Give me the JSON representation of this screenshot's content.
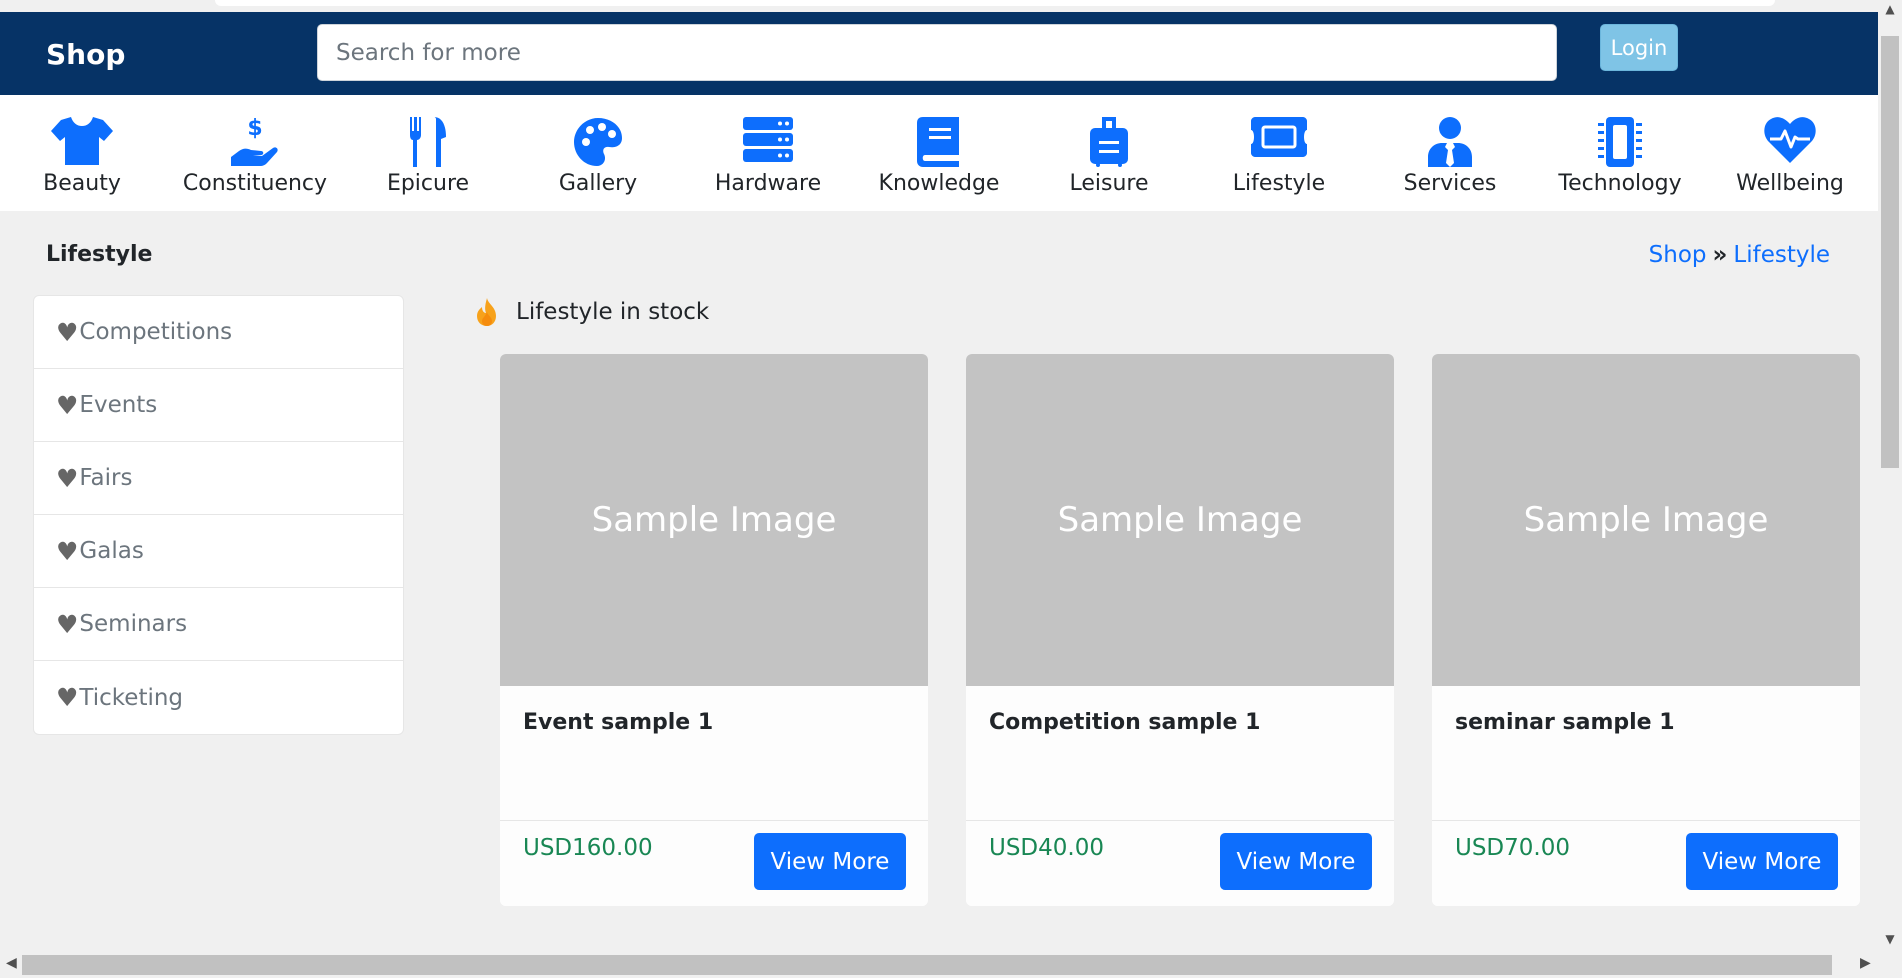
{
  "header": {
    "brand": "Shop",
    "search_placeholder": "Search for more",
    "login_label": "Login"
  },
  "categories": [
    {
      "label": "Beauty",
      "icon": "tshirt-icon"
    },
    {
      "label": "Constituency",
      "icon": "hand-dollar-icon"
    },
    {
      "label": "Epicure",
      "icon": "utensils-icon"
    },
    {
      "label": "Gallery",
      "icon": "palette-icon"
    },
    {
      "label": "Hardware",
      "icon": "server-icon"
    },
    {
      "label": "Knowledge",
      "icon": "book-icon"
    },
    {
      "label": "Leisure",
      "icon": "suitcase-icon"
    },
    {
      "label": "Lifestyle",
      "icon": "ticket-icon"
    },
    {
      "label": "Services",
      "icon": "user-tie-icon"
    },
    {
      "label": "Technology",
      "icon": "microchip-icon"
    },
    {
      "label": "Wellbeing",
      "icon": "heart-pulse-icon"
    }
  ],
  "section": {
    "title": "Lifestyle",
    "breadcrumb": {
      "root": "Shop",
      "current": "Lifestyle"
    },
    "stock_label": "Lifestyle in stock"
  },
  "sidebar": {
    "items": [
      {
        "label": "Competitions"
      },
      {
        "label": "Events"
      },
      {
        "label": "Fairs"
      },
      {
        "label": "Galas"
      },
      {
        "label": "Seminars"
      },
      {
        "label": "Ticketing"
      }
    ]
  },
  "products": [
    {
      "image_text": "Sample Image",
      "name": "Event sample 1",
      "price": "USD160.00",
      "button": "View More"
    },
    {
      "image_text": "Sample Image",
      "name": "Competition sample 1",
      "price": "USD40.00",
      "button": "View More"
    },
    {
      "image_text": "Sample Image",
      "name": "seminar sample 1",
      "price": "USD70.00",
      "button": "View More"
    }
  ],
  "colors": {
    "navbar": "#063366",
    "accent": "#0d6efd",
    "price": "#198754",
    "login": "#7fc4e6"
  }
}
